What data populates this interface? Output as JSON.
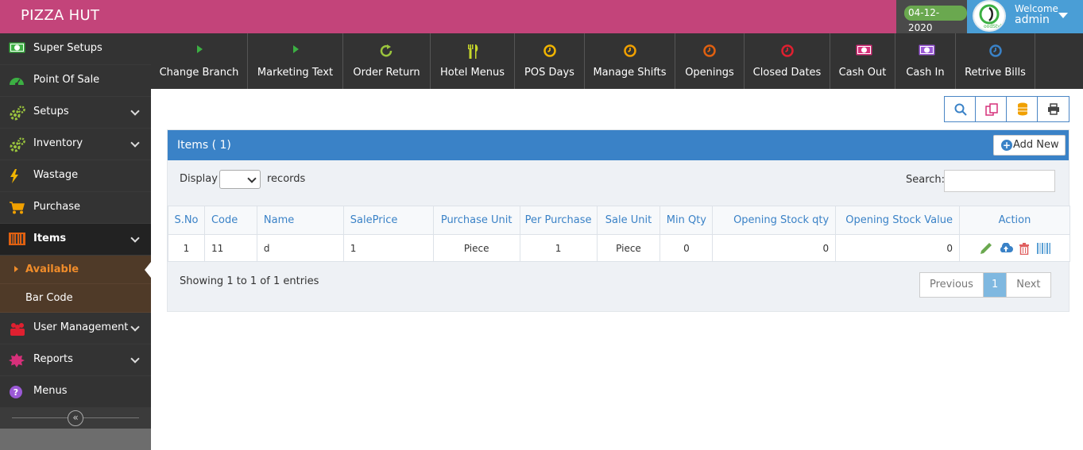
{
  "header": {
    "brand": "PIZZA HUT",
    "date": "04-12-2020",
    "welcome": "Welcome",
    "username": "admin",
    "colors": {
      "bar": "#c3447a",
      "user": "#4a9ed6",
      "date_badge": "#6aa84f"
    }
  },
  "sidebar": {
    "items": [
      {
        "label": "Super Setups",
        "icon": "money-icon",
        "color": "#3cb043",
        "has_chevron": false
      },
      {
        "label": "Point Of Sale",
        "icon": "dashboard-icon",
        "color": "#3cb043",
        "has_chevron": false
      },
      {
        "label": "Setups",
        "icon": "gears-icon",
        "color": "#9bc53d",
        "has_chevron": true
      },
      {
        "label": "Inventory",
        "icon": "gears-icon",
        "color": "#9bc53d",
        "has_chevron": true
      },
      {
        "label": "Wastage",
        "icon": "bolt-icon",
        "color": "#f0b400",
        "has_chevron": false
      },
      {
        "label": "Purchase",
        "icon": "cart-icon",
        "color": "#f0a000",
        "has_chevron": false
      },
      {
        "label": "Items",
        "icon": "barcode-icon",
        "color": "#e06010",
        "has_chevron": true,
        "active": true
      },
      {
        "label": "User Management",
        "icon": "users-icon",
        "color": "#e02030",
        "has_chevron": true
      },
      {
        "label": "Reports",
        "icon": "badge-icon",
        "color": "#d6307a",
        "has_chevron": true
      },
      {
        "label": "Menus",
        "icon": "question-icon",
        "color": "#9b59d6",
        "has_chevron": false
      }
    ],
    "submenu": [
      {
        "label": "Available",
        "current": true
      },
      {
        "label": "Bar Code",
        "current": false
      }
    ],
    "collapse_glyph": "«"
  },
  "toolbar": [
    {
      "label": "Change Branch",
      "icon": "play-icon",
      "color": "#3cb043"
    },
    {
      "label": "Marketing Text",
      "icon": "play-icon",
      "color": "#3cb043"
    },
    {
      "label": "Order Return",
      "icon": "refresh-icon",
      "color": "#9bc53d"
    },
    {
      "label": "Hotel Menus",
      "icon": "cutlery-icon",
      "color": "#c8d92a"
    },
    {
      "label": "POS Days",
      "icon": "clock-icon",
      "color": "#f0b400"
    },
    {
      "label": "Manage Shifts",
      "icon": "clock-icon",
      "color": "#f0a000"
    },
    {
      "label": "Openings",
      "icon": "clock-icon",
      "color": "#e06010"
    },
    {
      "label": "Closed Dates",
      "icon": "clock-icon",
      "color": "#e02030"
    },
    {
      "label": "Cash Out",
      "icon": "money-icon",
      "color": "#d6307a"
    },
    {
      "label": "Cash In",
      "icon": "money-icon",
      "color": "#9b59d6"
    },
    {
      "label": "Retrive Bills",
      "icon": "clock-icon",
      "color": "#3a82c7"
    }
  ],
  "actions": {
    "buttons": [
      "search-icon",
      "copy-icon",
      "database-icon",
      "print-icon"
    ]
  },
  "panel": {
    "title": "Items ( 1)",
    "add_new": "Add New",
    "display_label": "Display",
    "records_label": "records",
    "search_label": "Search:",
    "search_value": "",
    "columns": [
      "S.No",
      "Code",
      "Name",
      "SalePrice",
      "Purchase Unit",
      "Per Purchase",
      "Sale Unit",
      "Min Qty",
      "Opening Stock qty",
      "Opening Stock Value",
      "Action"
    ],
    "rows": [
      {
        "sno": "1",
        "code": "11",
        "name": "d",
        "sale_price": "1",
        "purchase_unit": "Piece",
        "per_purchase": "1",
        "sale_unit": "Piece",
        "min_qty": "0",
        "opening_qty": "0",
        "opening_value": "0"
      }
    ],
    "row_actions": [
      "edit-icon",
      "upload-icon",
      "delete-icon",
      "barcode-icon"
    ],
    "showing": "Showing 1 to 1 of 1 entries",
    "pagination": {
      "previous": "Previous",
      "current": "1",
      "next": "Next"
    }
  }
}
